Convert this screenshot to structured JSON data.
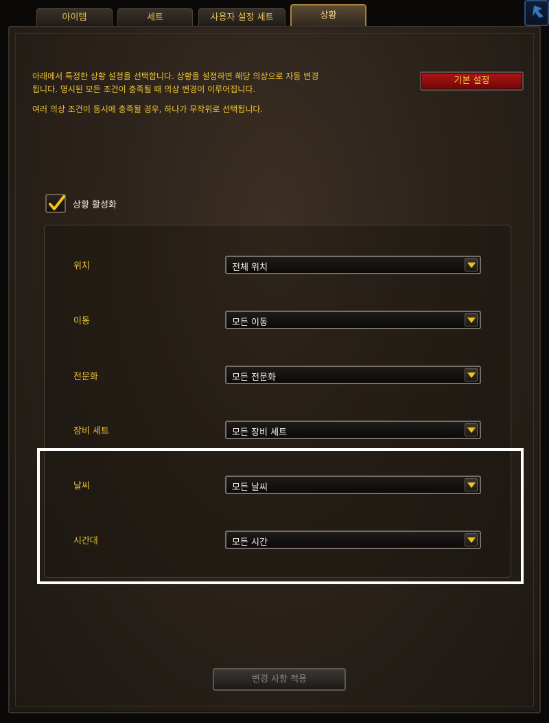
{
  "tabs": [
    {
      "label": "아이템"
    },
    {
      "label": "세트"
    },
    {
      "label": "사용자 설정 세트"
    },
    {
      "label": "상황",
      "active": true
    }
  ],
  "description": {
    "line1": "아래에서 특정한 상황 설정을 선택합니다. 상황을 설정하면 해당 의상으로 자동 변경",
    "line2": "됩니다. 명시된 모든 조건이 충족될 때 의상 변경이 이루어집니다.",
    "line3": "여러 의상 조건이 동시에 충족될 경우, 하나가 무작위로 선택됩니다."
  },
  "reset_button": {
    "label": "기본 설정"
  },
  "enable_checkbox": {
    "label": "상황 활성화",
    "checked": true
  },
  "filters": [
    {
      "label": "위치",
      "value": "전체 위치"
    },
    {
      "label": "이동",
      "value": "모든 이동"
    },
    {
      "label": "전문화",
      "value": "모든 전문화"
    },
    {
      "label": "장비 세트",
      "value": "모든 장비 세트"
    },
    {
      "label": "날씨",
      "value": "모든 날씨"
    },
    {
      "label": "시간대",
      "value": "모든 시간"
    }
  ],
  "apply_button": {
    "label": "변경 사항 적용",
    "enabled": false
  },
  "colors": {
    "accent_gold": "#f0c533",
    "reset_red": "#b01616",
    "highlight": "#ffffff"
  },
  "icons": {
    "checkbox": "check-icon",
    "dropdown": "triangle-down-icon"
  }
}
